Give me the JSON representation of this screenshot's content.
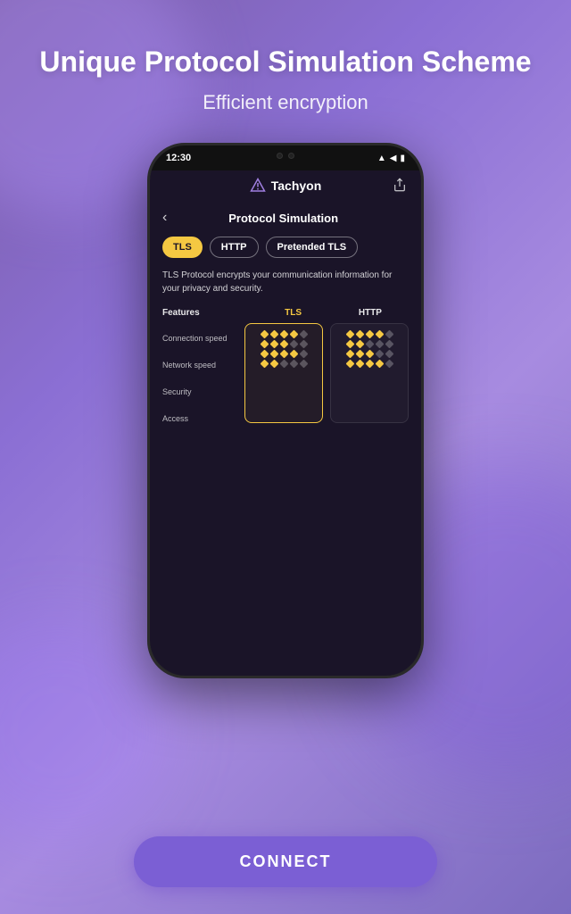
{
  "background": {
    "gradient_start": "#7b5ea7",
    "gradient_end": "#a78be0"
  },
  "header": {
    "headline": "Unique Protocol Simulation Scheme",
    "subtitle": "Efficient encryption"
  },
  "phone": {
    "status_bar": {
      "time": "12:30",
      "icons": [
        "▲",
        "◀",
        "▮"
      ]
    },
    "nav": {
      "app_name": "Tachyon",
      "share_icon": "⬆"
    },
    "screen": {
      "back_icon": "‹",
      "section_title": "Protocol Simulation",
      "tabs": [
        {
          "label": "TLS",
          "active": true
        },
        {
          "label": "HTTP",
          "active": false
        },
        {
          "label": "Pretended TLS",
          "active": false
        }
      ],
      "description": "TLS Protocol encrypts your communication information for your privacy and security.",
      "comparison": {
        "col_features": "Features",
        "col_tls": "TLS",
        "col_http": "HTTP",
        "rows": [
          "Connection speed",
          "Network speed",
          "Security",
          "Access"
        ],
        "tls_grid": [
          [
            1,
            1,
            1,
            1,
            0
          ],
          [
            1,
            1,
            1,
            0,
            0
          ],
          [
            1,
            1,
            1,
            1,
            0
          ],
          [
            1,
            1,
            0,
            0,
            0
          ]
        ],
        "http_grid": [
          [
            1,
            1,
            1,
            1,
            0
          ],
          [
            1,
            1,
            0,
            0,
            0
          ],
          [
            1,
            1,
            1,
            0,
            0
          ],
          [
            1,
            1,
            1,
            1,
            0
          ]
        ]
      }
    }
  },
  "connect_button": {
    "label": "CONNECT"
  }
}
